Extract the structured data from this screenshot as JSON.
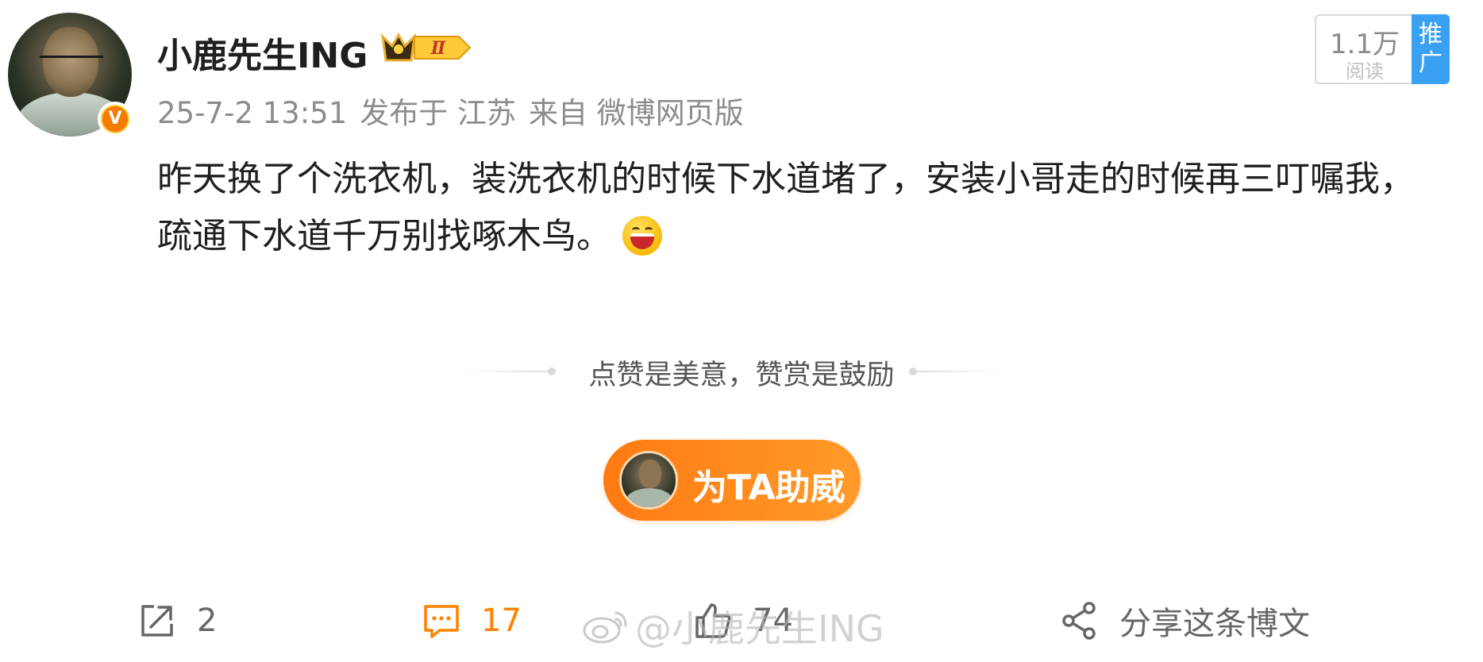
{
  "post": {
    "author": {
      "name": "小鹿先生ING",
      "verified_badge": "V",
      "vip_level": "Ⅱ"
    },
    "meta": {
      "date": "25-7-2 13:51",
      "location": "发布于 江苏",
      "source": "来自 微博网页版"
    },
    "reads": {
      "count": "1.1万",
      "label": "阅读",
      "promote_label": "推广"
    },
    "content": {
      "line1": "昨天换了个洗衣机，装洗衣机的时候下水道堵了，安装小哥走的时候再三叮嘱我，",
      "line2": "疏通下水道千万别找啄木鸟。",
      "emoji": "laughing-emoji"
    }
  },
  "reward": {
    "tagline": "点赞是美意，赞赏是鼓励",
    "cheer_button": "为TA助威"
  },
  "actions": {
    "repost": {
      "icon": "repost-icon",
      "count": "2"
    },
    "comment": {
      "icon": "comment-icon",
      "count": "17"
    },
    "like": {
      "icon": "like-icon",
      "count": "74"
    },
    "share": {
      "icon": "share-icon",
      "label": "分享这条博文"
    }
  },
  "watermark": {
    "text": "@小鹿先生ING"
  },
  "colors": {
    "accent_orange": "#ff8200",
    "promote_blue": "#3aa0f2",
    "meta_gray": "#8c8c8c"
  }
}
